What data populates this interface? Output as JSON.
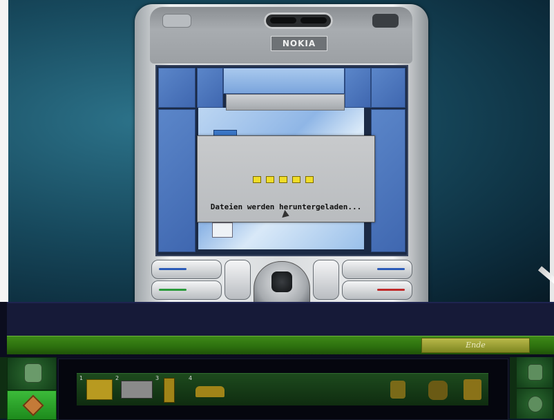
{
  "phone": {
    "brand": "NOKIA",
    "dialog_message": "Dateien werden heruntergeladen...",
    "progress_dots": 5
  },
  "panel": {
    "dialog_text": "",
    "end_button": "Ende"
  },
  "inventory": {
    "slot_numbers": [
      "1",
      "2",
      "3",
      "4"
    ],
    "items": [
      "ticket-icon",
      "film-strip-icon",
      "bottle-icon",
      "car-icon",
      "badge-icon",
      "footprints-icon",
      "paper-bag-icon"
    ]
  },
  "colors": {
    "panel_green": "#2c6e0e",
    "dialog_bg": "#c8cacc",
    "screen_blue": "#5b86c9",
    "progress_dot": "#f0dd2a"
  }
}
